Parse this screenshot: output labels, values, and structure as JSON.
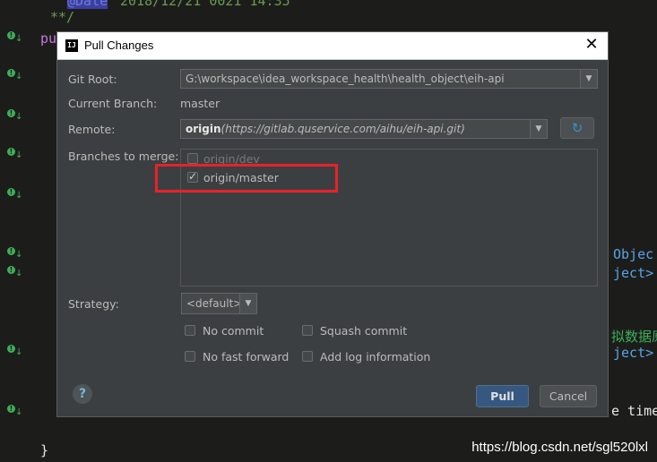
{
  "editor": {
    "line_top_comment": "@Date 2018/12/21 0021 14:35",
    "line_end_comment": "**/",
    "line_pu": "pu",
    "right_obj1": "Objec",
    "right_obj2": "ject> v",
    "right_cn": "拟数据原",
    "right_obj3": "ject>",
    "right_time": "e time",
    "closing_brace": "}",
    "watermark": "https://blog.csdn.net/sgl520lxl"
  },
  "dialog": {
    "title": "Pull Changes",
    "app_logo": "IJ",
    "git_root_label": "Git Root:",
    "git_root_value": "G:\\workspace\\idea_workspace_health\\health_object\\eih-api",
    "current_branch_label": "Current Branch:",
    "current_branch_value": "master",
    "remote_label": "Remote:",
    "remote_name": "origin",
    "remote_url": "(https://gitlab.quservice.com/aihu/eih-api.git)",
    "branches_label": "Branches to merge:",
    "branches": [
      {
        "label": "origin/dev",
        "checked": false
      },
      {
        "label": "origin/master",
        "checked": true
      }
    ],
    "strategy_label": "Strategy:",
    "strategy_value": "<default>",
    "options": {
      "no_commit": "No commit",
      "squash_commit": "Squash commit",
      "no_fast_forward": "No fast forward",
      "add_log_information": "Add log information"
    },
    "help_label": "?",
    "pull_label": "Pull",
    "cancel_label": "Cancel",
    "close_label": "✕"
  },
  "colors": {
    "dialog_bg": "#3c3f41",
    "highlight_box": "#e8222a",
    "primary_button": "#365880"
  }
}
